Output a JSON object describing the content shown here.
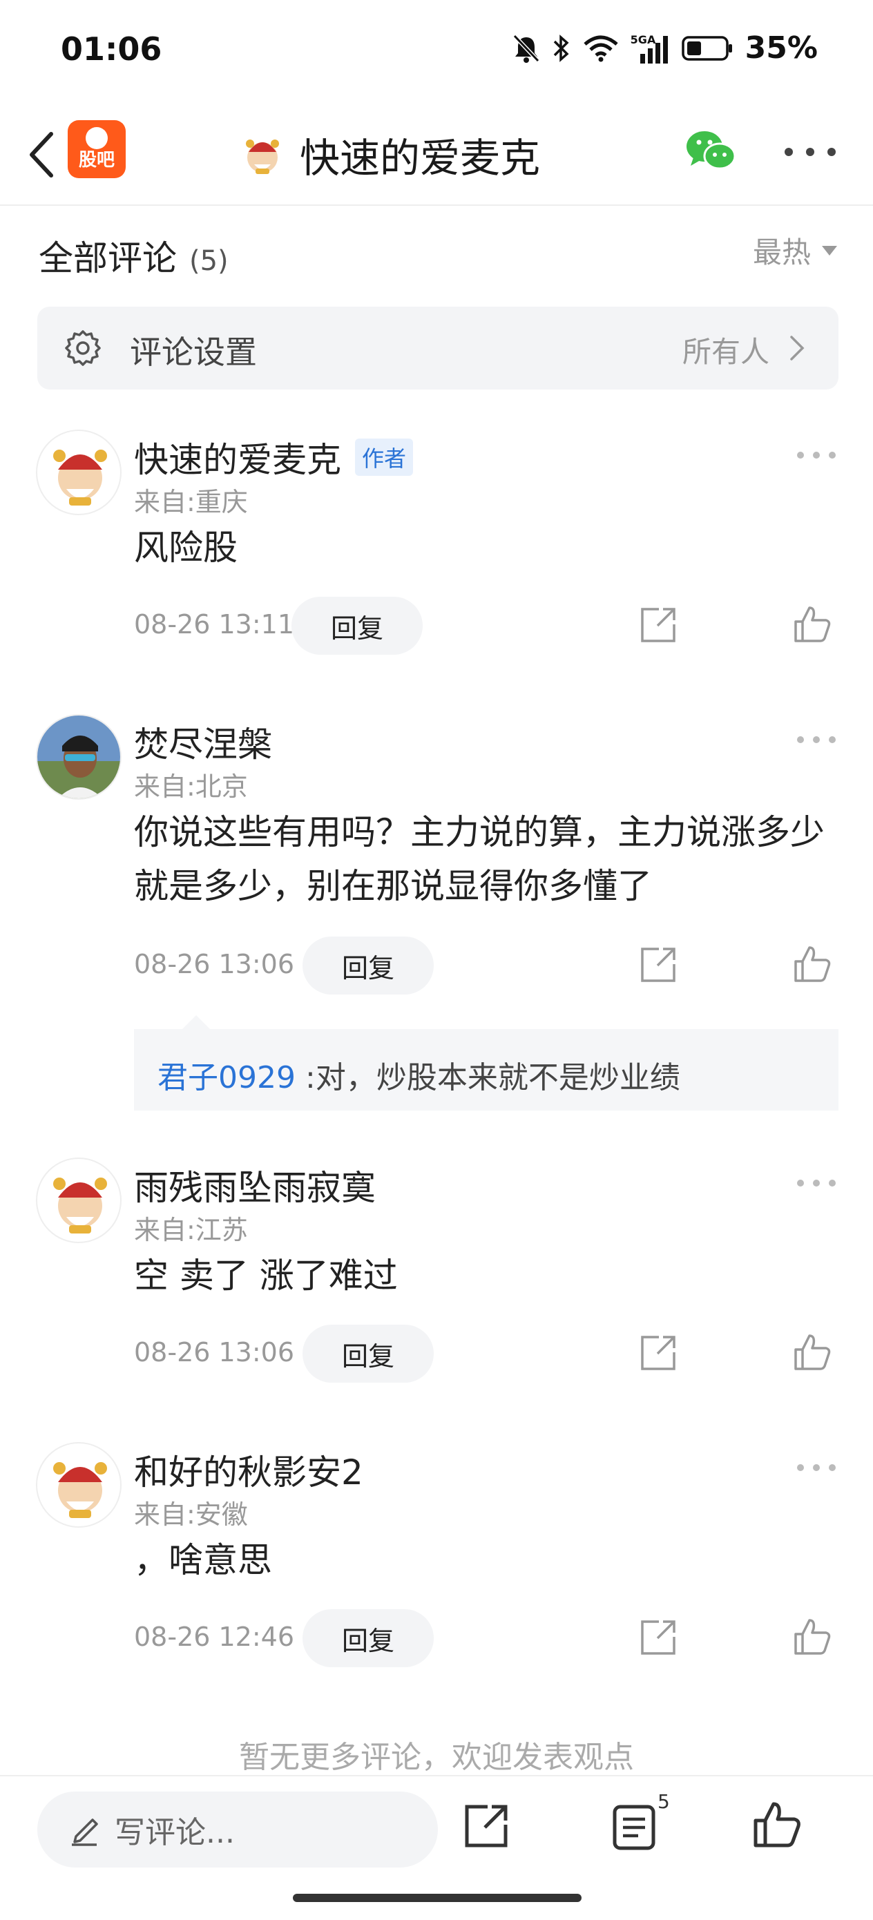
{
  "status_bar": {
    "time": "01:06",
    "network": "5GA",
    "battery": "35%",
    "icons": [
      "mute-bell-icon",
      "bluetooth-icon",
      "wifi-icon",
      "signal-icon",
      "battery-icon"
    ]
  },
  "header": {
    "app_logo_text": "股吧",
    "title": "快速的爱麦克",
    "icons": [
      "back-arrow-icon",
      "avatar-icon",
      "wechat-icon",
      "more-icon"
    ]
  },
  "comments_section": {
    "title": "全部评论",
    "count": "(5)",
    "sort_label": "最热"
  },
  "settings": {
    "label": "评论设置",
    "value": "所有人"
  },
  "comments": [
    {
      "username": "快速的爱麦克",
      "badge": "作者",
      "location": "来自:重庆",
      "text": "风险股",
      "time": "08-26 13:11",
      "reply_label": "回复"
    },
    {
      "username": "焚尽涅槃",
      "location": "来自:北京",
      "text": "你说这些有用吗？主力说的算，主力说涨多少就是多少，别在那说显得你多懂了",
      "time": "08-26 13:06",
      "reply_label": "回复",
      "sub_reply": {
        "user": "君子0929",
        "text": ":对，炒股本来就不是炒业绩"
      }
    },
    {
      "username": "雨残雨坠雨寂寞",
      "location": "来自:江苏",
      "text": "空 卖了 涨了难过",
      "time": "08-26 13:06",
      "reply_label": "回复"
    },
    {
      "username": "和好的秋影安2",
      "location": "来自:安徽",
      "text": "，啥意思",
      "time": "08-26 12:46",
      "reply_label": "回复"
    }
  ],
  "footer_note": "暂无更多评论，欢迎发表观点",
  "bottom_bar": {
    "input_placeholder": "写评论...",
    "comment_count": "5"
  },
  "colors": {
    "accent_blue": "#2a73d6",
    "app_orange": "#ff5a1a",
    "wechat_green": "#3fbf4a"
  }
}
